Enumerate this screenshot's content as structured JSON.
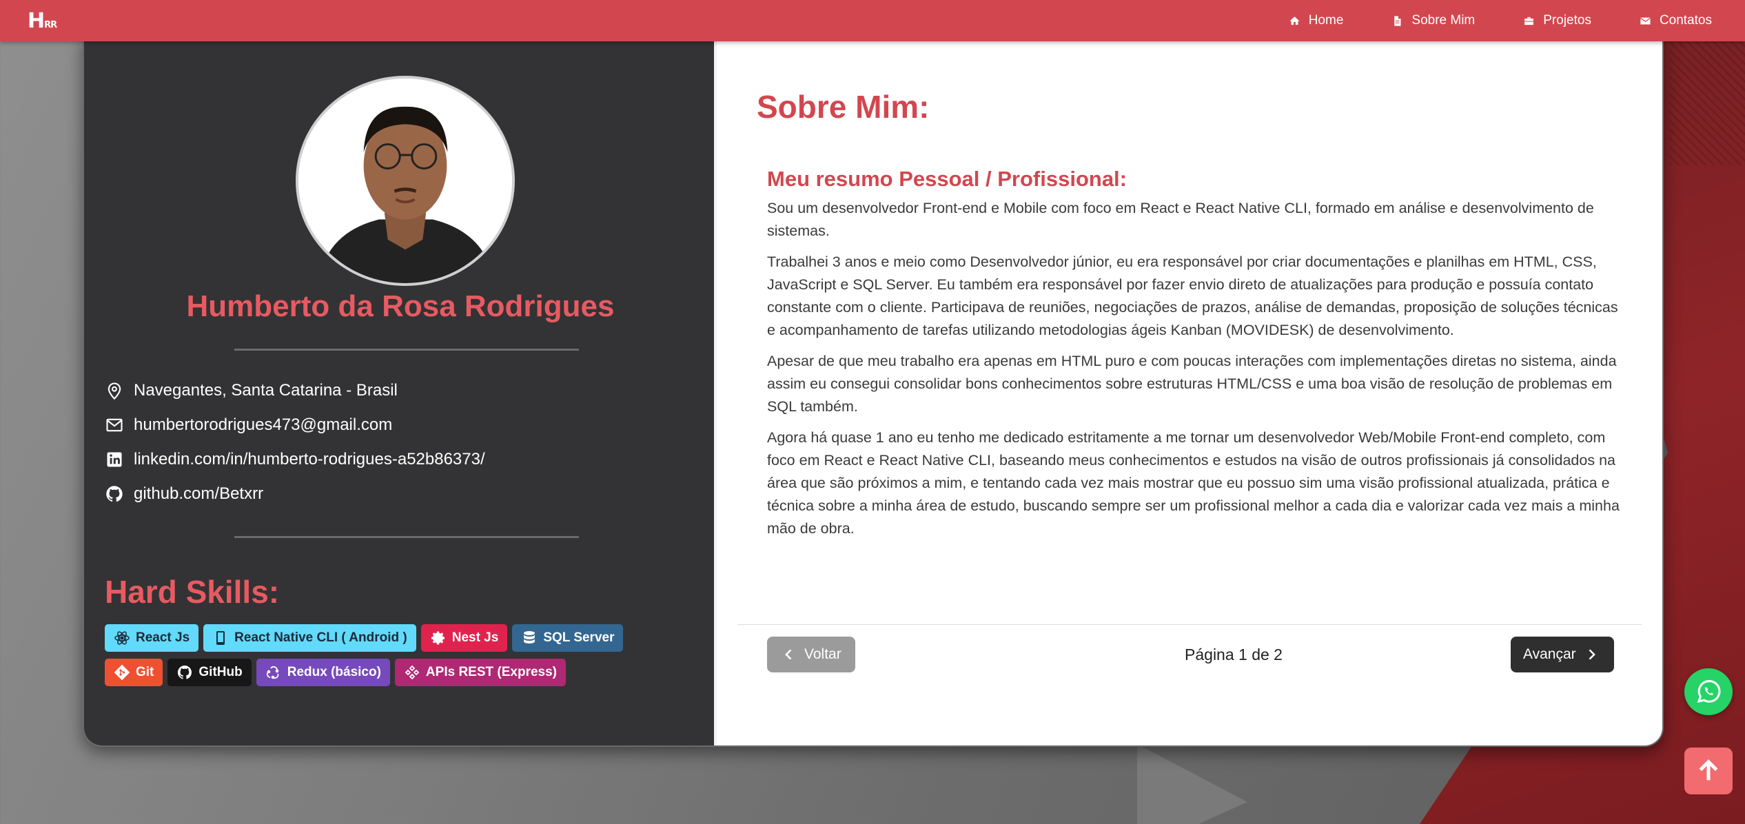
{
  "navbar": {
    "logo_main": "H",
    "logo_sub": "RR",
    "links": [
      {
        "label": "Home",
        "icon": "home-icon"
      },
      {
        "label": "Sobre Mim",
        "icon": "document-icon"
      },
      {
        "label": "Projetos",
        "icon": "briefcase-icon"
      },
      {
        "label": "Contatos",
        "icon": "envelope-icon"
      }
    ]
  },
  "profile": {
    "name": "Humberto da Rosa Rodrigues",
    "contacts": [
      {
        "icon": "location-pin-icon",
        "text": "Navegantes, Santa Catarina - Brasil"
      },
      {
        "icon": "mail-icon",
        "text": "humbertorodrigues473@gmail.com"
      },
      {
        "icon": "linkedin-icon",
        "text": "linkedin.com/in/humberto-rodrigues-a52b86373/"
      },
      {
        "icon": "github-icon",
        "text": "github.com/Betxrr"
      }
    ],
    "skills_title": "Hard Skills:",
    "skills": [
      {
        "label": "React Js",
        "color": "#61dafb",
        "text_color": "#1c2a3a",
        "icon": "react-icon"
      },
      {
        "label": "React Native CLI ( Android )",
        "color": "#61dafb",
        "text_color": "#1c2a3a",
        "icon": "mobile-icon"
      },
      {
        "label": "Nest Js",
        "color": "#e0234e",
        "text_color": "#ffffff",
        "icon": "nest-gear-icon"
      },
      {
        "label": "SQL Server",
        "color": "#336791",
        "text_color": "#ffffff",
        "icon": "database-icon"
      },
      {
        "label": "Git",
        "color": "#f05032",
        "text_color": "#ffffff",
        "icon": "git-icon"
      },
      {
        "label": "GitHub",
        "color": "#181717",
        "text_color": "#ffffff",
        "icon": "github-icon"
      },
      {
        "label": "Redux (básico)",
        "color": "#764abc",
        "text_color": "#ffffff",
        "icon": "redux-icon"
      },
      {
        "label": "APIs REST (Express)",
        "color": "#b02873",
        "text_color": "#ffffff",
        "icon": "api-icon"
      }
    ]
  },
  "about": {
    "title": "Sobre Mim:",
    "subtitle": "Meu resumo Pessoal / Profissional:",
    "paragraphs": [
      "Sou um desenvolvedor Front-end e Mobile com foco em React e React Native CLI, formado em análise e desenvolvimento de sistemas.",
      "Trabalhei 3 anos e meio como Desenvolvedor júnior, eu era responsável por criar documentações e planilhas em HTML, CSS, JavaScript e SQL Server. Eu também era responsável por fazer envio direto de atualizações para produção e possuía contato constante com o cliente. Participava de reuniões, negociações de prazos, análise de demandas, proposição de soluções técnicas e acompanhamento de tarefas utilizando metodologias ágeis Kanban (MOVIDESK) de desenvolvimento.",
      "Apesar de que meu trabalho era apenas em HTML puro e com poucas interações com implementações diretas no sistema, ainda assim eu consegui consolidar bons conhecimentos sobre estruturas HTML/CSS e uma boa visão de resolução de problemas em SQL também.",
      "Agora há quase 1 ano eu tenho me dedicado estritamente a me tornar um desenvolvedor Web/Mobile Front-end completo, com foco em React e React Native CLI, baseando meus conhecimentos e estudos na visão de outros profissionais já consolidados na área que são próximos a mim, e tentando cada vez mais mostrar que eu possuo sim uma visão profissional atualizada, prática e técnica sobre a minha área de estudo, buscando sempre ser um profissional melhor a cada dia e valorizar cada vez mais a minha mão de obra."
    ],
    "back_label": "Voltar",
    "next_label": "Avançar",
    "page_indicator": "Página 1 de 2"
  },
  "colors": {
    "accent": "#d2474f",
    "name": "#e85a61",
    "sidebar_bg": "#333335",
    "whatsapp": "#25d366",
    "scroll_top": "#f26b6f"
  }
}
